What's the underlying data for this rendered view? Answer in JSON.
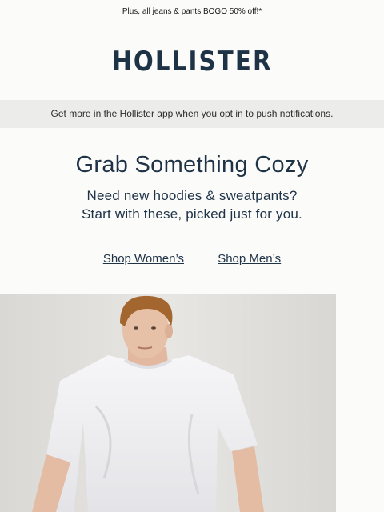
{
  "promo_banner": {
    "text": "Plus, all jeans & pants BOGO 50% off!*"
  },
  "brand": {
    "logo_text": "HOLLISTER"
  },
  "app_bar": {
    "prefix": "Get more ",
    "link": "in the Hollister app",
    "suffix": " when you opt in to push notifications."
  },
  "hero_text": {
    "headline": "Grab Something Cozy",
    "subline_1": "Need new hoodies & sweatpants?",
    "subline_2": "Start with these, picked just for you."
  },
  "shop_links": {
    "women": "Shop Women’s",
    "men": "Shop Men’s"
  },
  "colors": {
    "navy": "#1f3347",
    "app_bar_bg": "#ececea",
    "page_bg": "#fbfbfa"
  }
}
